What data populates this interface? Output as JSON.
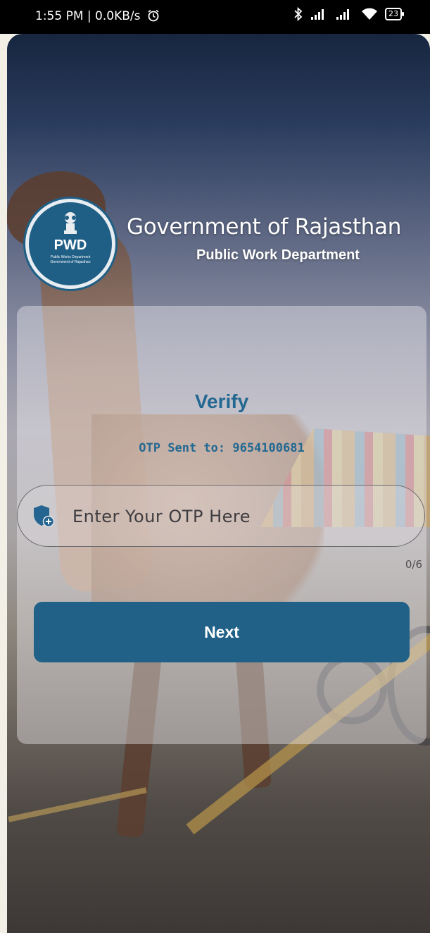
{
  "status_bar": {
    "time": "1:55 PM | 0.0KB/s",
    "icons": [
      "alarm-icon",
      "bluetooth-icon",
      "signal-icon",
      "signal-icon",
      "wifi-icon",
      "battery-icon"
    ],
    "battery": "23"
  },
  "header": {
    "logo": {
      "abbr": "PWD",
      "line1": "Public Works Department",
      "line2": "Government of Rajasthan"
    },
    "title": "Government of Rajasthan",
    "subtitle": "Public Work Department"
  },
  "card": {
    "heading": "Verify",
    "otp_sent": "OTP Sent to: 9654100681",
    "otp_input": {
      "placeholder": "Enter Your OTP Here",
      "value": "",
      "icon": "shield-plus-icon"
    },
    "counter": "0/6",
    "next_label": "Next"
  },
  "colors": {
    "accent": "#226891",
    "button": "#216187",
    "status_bar_bg": "#000000"
  }
}
